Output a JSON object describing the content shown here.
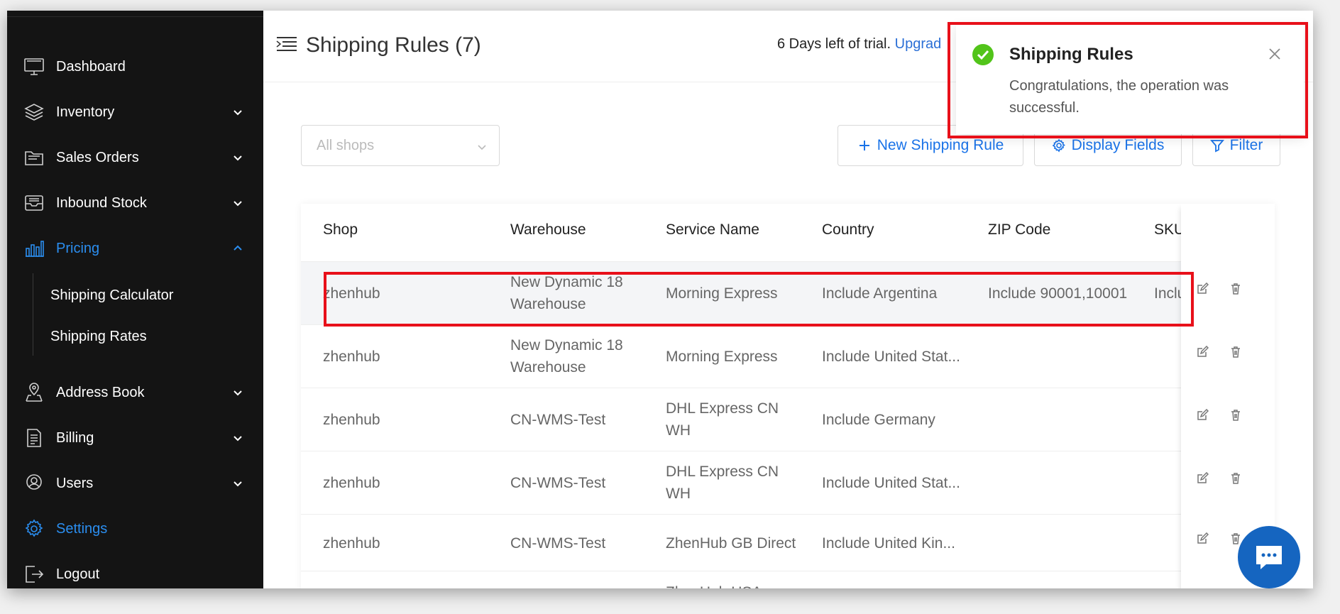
{
  "sidebar": {
    "items": [
      {
        "label": "Dashboard",
        "icon": "monitor-icon"
      },
      {
        "label": "Inventory",
        "icon": "layers-icon"
      },
      {
        "label": "Sales Orders",
        "icon": "folder-icon"
      },
      {
        "label": "Inbound Stock",
        "icon": "inbox-icon"
      },
      {
        "label": "Pricing",
        "icon": "bar-chart-icon"
      },
      {
        "label": "Address Book",
        "icon": "map-pin-icon"
      },
      {
        "label": "Billing",
        "icon": "document-icon"
      },
      {
        "label": "Users",
        "icon": "user-icon"
      },
      {
        "label": "Settings",
        "icon": "gear-icon"
      },
      {
        "label": "Logout",
        "icon": "logout-icon"
      }
    ],
    "pricing_sub": [
      "Shipping Calculator",
      "Shipping Rates"
    ]
  },
  "header": {
    "title": "Shipping Rules (7)",
    "trial_text": "6 Days left of trial.",
    "upgrade_link": "Upgrad",
    "close": "×"
  },
  "filters": {
    "shop_placeholder": "All shops",
    "new_rule": "New Shipping Rule",
    "display_fields": "Display Fields",
    "filter": "Filter"
  },
  "table": {
    "columns": [
      "Shop",
      "Warehouse",
      "Service Name",
      "Country",
      "ZIP Code",
      "SKU"
    ],
    "rows": [
      {
        "shop": "zhenhub",
        "warehouse": "New Dynamic 18 Warehouse",
        "service": "Morning Express",
        "country": "Include Argentina",
        "zip": "Include 90001,10001",
        "sku": "Inclu"
      },
      {
        "shop": "zhenhub",
        "warehouse": "New Dynamic 18 Warehouse",
        "service": "Morning Express",
        "country": "Include United Stat...",
        "zip": "",
        "sku": ""
      },
      {
        "shop": "zhenhub",
        "warehouse": "CN-WMS-Test",
        "service": "DHL Express CN WH",
        "country": "Include Germany",
        "zip": "",
        "sku": ""
      },
      {
        "shop": "zhenhub",
        "warehouse": "CN-WMS-Test",
        "service": "DHL Express CN WH",
        "country": "Include United Stat...",
        "zip": "",
        "sku": ""
      },
      {
        "shop": "zhenhub",
        "warehouse": "CN-WMS-Test",
        "service": "ZhenHub GB Direct",
        "country": "Include United Kin...",
        "zip": "",
        "sku": ""
      },
      {
        "shop": "",
        "warehouse": "",
        "service": "ZhenHub USA",
        "country": "",
        "zip": "",
        "sku": ""
      }
    ]
  },
  "toast": {
    "title": "Shipping Rules",
    "message": "Congratulations, the operation was successful."
  },
  "colors": {
    "accent": "#2b8ef0",
    "highlight": "#e8101a",
    "success": "#52c41a",
    "chat": "#1565c0"
  }
}
